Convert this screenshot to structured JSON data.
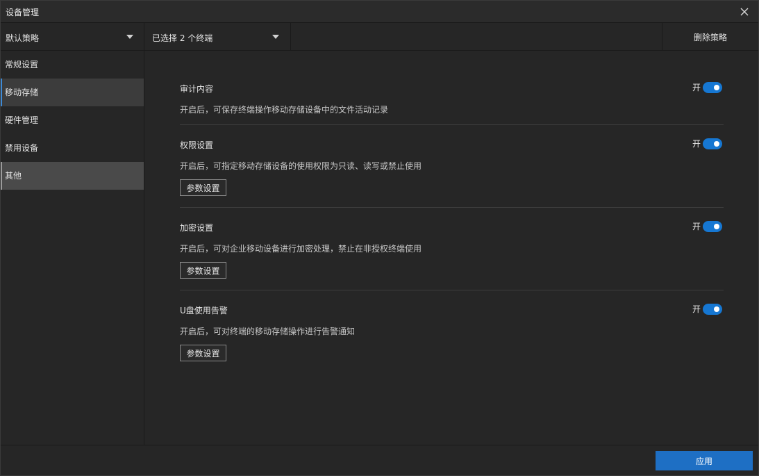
{
  "window": {
    "title": "设备管理",
    "close_icon": "close-icon"
  },
  "toolbar": {
    "policy_label": "默认策略",
    "terminal_label": "已选择 2 个终端",
    "delete_label": "删除策略"
  },
  "sidebar": {
    "items": [
      {
        "label": "常规设置"
      },
      {
        "label": "移动存储"
      },
      {
        "label": "硬件管理"
      },
      {
        "label": "禁用设备"
      },
      {
        "label": "其他"
      }
    ]
  },
  "sections": [
    {
      "title": "审计内容",
      "desc": "开启后，可保存终端操作移动存储设备中的文件活动记录",
      "switch_label": "开",
      "enabled": true
    },
    {
      "title": "权限设置",
      "desc": "开启后，可指定移动存储设备的使用权限为只读、读写或禁止使用",
      "switch_label": "开",
      "enabled": true,
      "button": "参数设置"
    },
    {
      "title": "加密设置",
      "desc": "开启后，可对企业移动设备进行加密处理，禁止在非授权终端使用",
      "switch_label": "开",
      "enabled": true,
      "button": "参数设置"
    },
    {
      "title": "U盘使用告警",
      "desc": "开启后，可对终端的移动存储操作进行告警通知",
      "switch_label": "开",
      "enabled": true,
      "button": "参数设置"
    }
  ],
  "footer": {
    "apply_label": "应用"
  },
  "colors": {
    "accent": "#1e6fc4",
    "switch_on": "#1677d2",
    "background": "#262626"
  }
}
